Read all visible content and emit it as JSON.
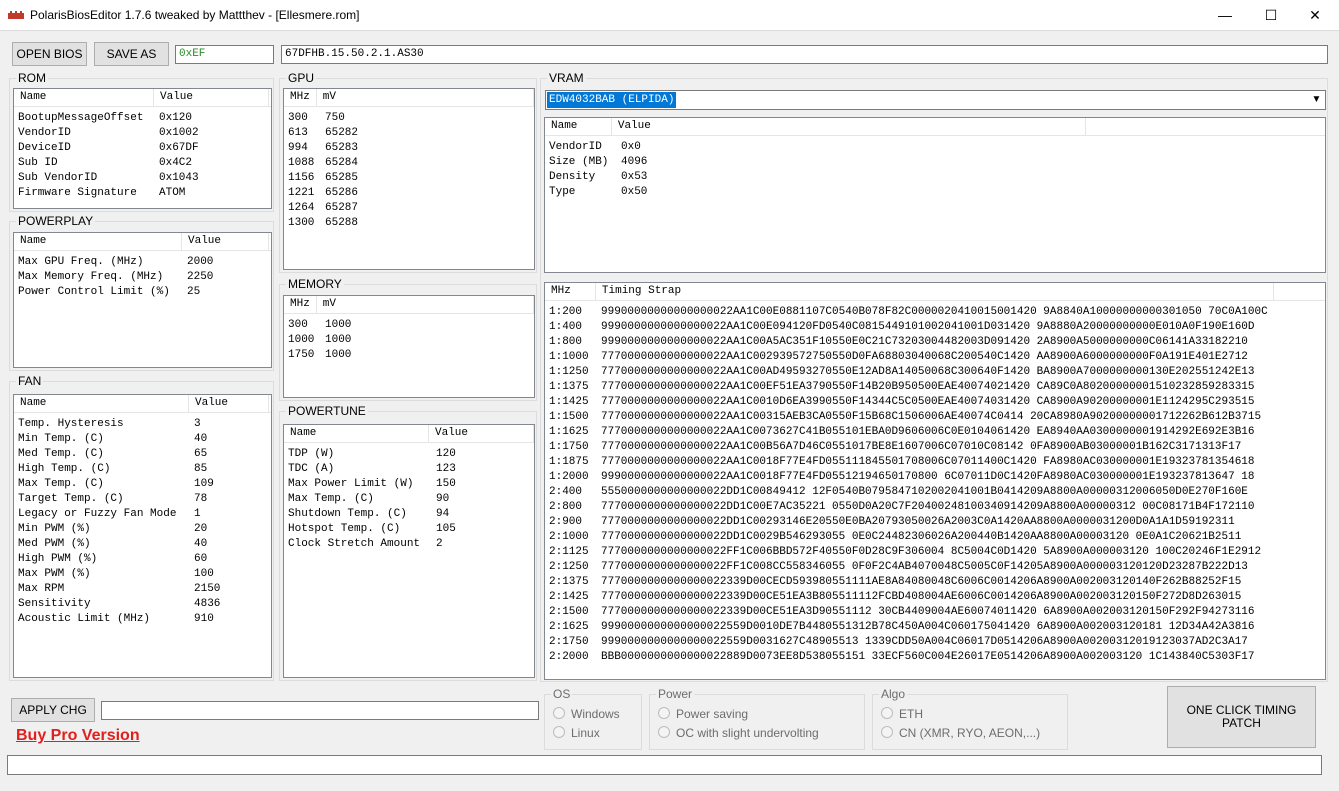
{
  "window": {
    "title": "PolarisBiosEditor 1.7.6 tweaked by Mattthev  - [Ellesmere.rom]",
    "minimize": "—",
    "maximize": "☐",
    "close": "✕"
  },
  "toolbar": {
    "open_bios": "OPEN BIOS",
    "save_as": "SAVE AS",
    "checksum": "0xEF",
    "bios_id": "67DFHB.15.50.2.1.AS30"
  },
  "rom": {
    "title": "ROM",
    "headers": [
      "Name",
      "Value"
    ],
    "rows": [
      [
        "BootupMessageOffset",
        "0x120"
      ],
      [
        "VendorID",
        "0x1002"
      ],
      [
        "DeviceID",
        "0x67DF"
      ],
      [
        "Sub ID",
        "0x4C2"
      ],
      [
        "Sub VendorID",
        "0x1043"
      ],
      [
        "Firmware Signature",
        "ATOM"
      ]
    ]
  },
  "powerplay": {
    "title": "POWERPLAY",
    "headers": [
      "Name",
      "Value"
    ],
    "rows": [
      [
        "Max GPU Freq. (MHz)",
        "2000"
      ],
      [
        "Max Memory Freq. (MHz)",
        "2250"
      ],
      [
        "Power Control Limit (%)",
        "25"
      ]
    ]
  },
  "fan": {
    "title": "FAN",
    "headers": [
      "Name",
      "Value"
    ],
    "rows": [
      [
        "Temp. Hysteresis",
        "3"
      ],
      [
        "Min Temp. (C)",
        "40"
      ],
      [
        "Med Temp. (C)",
        "65"
      ],
      [
        "High Temp. (C)",
        "85"
      ],
      [
        "Max Temp. (C)",
        "109"
      ],
      [
        "Target Temp. (C)",
        "78"
      ],
      [
        "Legacy or Fuzzy Fan Mode",
        "1"
      ],
      [
        "Min PWM (%)",
        "20"
      ],
      [
        "Med PWM (%)",
        "40"
      ],
      [
        "High PWM (%)",
        "60"
      ],
      [
        "Max PWM (%)",
        "100"
      ],
      [
        "Max RPM",
        "2150"
      ],
      [
        "Sensitivity",
        "4836"
      ],
      [
        "Acoustic Limit (MHz)",
        "910"
      ]
    ]
  },
  "gpu": {
    "title": "GPU",
    "headers": [
      "MHz",
      "mV"
    ],
    "rows": [
      [
        "300",
        "750"
      ],
      [
        "613",
        "65282"
      ],
      [
        "994",
        "65283"
      ],
      [
        "1088",
        "65284"
      ],
      [
        "1156",
        "65285"
      ],
      [
        "1221",
        "65286"
      ],
      [
        "1264",
        "65287"
      ],
      [
        "1300",
        "65288"
      ]
    ]
  },
  "memory": {
    "title": "MEMORY",
    "headers": [
      "MHz",
      "mV"
    ],
    "rows": [
      [
        "300",
        "1000"
      ],
      [
        "1000",
        "1000"
      ],
      [
        "1750",
        "1000"
      ]
    ]
  },
  "powertune": {
    "title": "POWERTUNE",
    "headers": [
      "Name",
      "Value"
    ],
    "rows": [
      [
        "TDP (W)",
        "120"
      ],
      [
        "TDC (A)",
        "123"
      ],
      [
        "Max Power Limit (W)",
        "150"
      ],
      [
        "Max Temp. (C)",
        "90"
      ],
      [
        "Shutdown Temp. (C)",
        "94"
      ],
      [
        "Hotspot Temp. (C)",
        "105"
      ],
      [
        "Clock Stretch Amount",
        "2"
      ]
    ]
  },
  "vram": {
    "title": "VRAM",
    "selected": "EDW4032BAB (ELPIDA)",
    "headers": [
      "Name",
      "Value"
    ],
    "rows": [
      [
        "VendorID",
        "0x0"
      ],
      [
        "Size (MB)",
        "4096"
      ],
      [
        "Density",
        "0x53"
      ],
      [
        "Type",
        "0x50"
      ]
    ]
  },
  "timings": {
    "headers": [
      "MHz",
      "Timing Strap"
    ],
    "rows": [
      [
        "1:200",
        "99900000000000000022AA1C00E0881107C0540B078F82C0000020410015001420 9A8840A10000000000301050 70C0A100C"
      ],
      [
        "1:400",
        "9990000000000000022AA1C00E094120FD0540C0815449101002041001D031420 9A8880A20000000000E010A0F190E160D"
      ],
      [
        "1:800",
        "9990000000000000022AA1C00A5AC351F10550E0C21C73203004482003D091420 2A8900A5000000000C06141A33182210"
      ],
      [
        "1:1000",
        "7770000000000000022AA1C002939572750550D0FA68803040068C200540C1420 AA8900A6000000000F0A191E401E2712"
      ],
      [
        "1:1250",
        "7770000000000000022AA1C00AD49593270550E12AD8A14050068C300640F1420 BA8900A7000000000130E202551242E13"
      ],
      [
        "1:1375",
        "7770000000000000022AA1C00EF51EA3790550F14B20B950500EAE40074021420 CA89C0A80200000001510232859283315"
      ],
      [
        "1:1425",
        "7770000000000000022AA1C0010D6EA3990550F14344C5C0500EAE40074031420 CA8900A90200000001E1124295C293515"
      ],
      [
        "1:1500",
        "7770000000000000022AA1C00315AEB3CA0550F15B68C1506006AE40074C0414 20CA8980A90200000001712262B612B3715"
      ],
      [
        "1:1625",
        "7770000000000000022AA1C0073627C41B055101EBA0D9606006C0E0104061420 EA8940AA0300000001914292E692E3B16"
      ],
      [
        "1:1750",
        "7770000000000000022AA1C00B56A7D46C0551017BE8E1607006C07010C08142 0FA8900AB03000001B162C3171313F17"
      ],
      [
        "1:1875",
        "7770000000000000022AA1C0018F77E4FD055111845501708006C07011400C1420 FA8980AC030000001E19323781354618"
      ],
      [
        "1:2000",
        "9990000000000000022AA1C0018F77E4FD05512194650170800 6C07011D0C1420FA8980AC030000001E193237813647 18"
      ],
      [
        "2:400",
        "5550000000000000022DD1C00849412 12F0540B0795847102002041001B0414209A8800A00000312006050D0E270F160E"
      ],
      [
        "2:800",
        "7770000000000000022DD1C00E7AC35221 0550D0A20C7F20400248100340914209A8800A00000312 00C08171B4F172110"
      ],
      [
        "2:900",
        "7770000000000000022DD1C00293146E20550E0BA20793050026A2003C0A1420AA8800A0000031200D0A1A1D59192311"
      ],
      [
        "2:1000",
        "7770000000000000022DD1C0029B546293055 0E0C24482306026A200440B1420AA8800A00003120 0E0A1C20621B2511"
      ],
      [
        "2:1125",
        "7770000000000000022FF1C006BBD572F40550F0D28C9F306004 8C5004C0D1420 5A8900A000003120 100C20246F1E2912"
      ],
      [
        "2:1250",
        "7770000000000000022FF1C008CC558346055 0F0F2C4AB4070048C5005C0F14205A8900A000003120120D23287B222D13"
      ],
      [
        "2:1375",
        "7770000000000000022339D00CECD593980551111AE8A84080048C6006C0014206A8900A002003120140F262B88252F15"
      ],
      [
        "2:1425",
        "7770000000000000022339D00CE51EA3B805511112FCBD408004AE6006C0014206A8900A002003120150F272D8D263015"
      ],
      [
        "2:1500",
        "7770000000000000022339D00CE51EA3D90551112 30CB4409004AE60074011420 6A8900A002003120150F292F94273116"
      ],
      [
        "2:1625",
        "9990000000000000022559D0010DE7B4480551312B78C450A004C060175041420 6A8900A002003120181 12D34A42A3816"
      ],
      [
        "2:1750",
        "9990000000000000022559D0031627C48905513 1339CDD50A004C06017D0514206A8900A00200312019123037AD2C3A17"
      ],
      [
        "2:2000",
        "BBB0000000000000022889D0073EE8D538055151 33ECF560C004E26017E0514206A8900A002003120 1C143840C5303F17"
      ]
    ]
  },
  "bottom": {
    "apply": "APPLY CHG",
    "status_field": "",
    "buy_pro": "Buy Pro Version",
    "one_click_line1": "ONE CLICK TIMING",
    "one_click_line2": "PATCH",
    "status_bar": ""
  },
  "os": {
    "title": "OS",
    "options": [
      "Windows",
      "Linux"
    ]
  },
  "power": {
    "title": "Power",
    "options": [
      "Power saving",
      "OC with slight undervolting"
    ]
  },
  "algo": {
    "title": "Algo",
    "options": [
      "ETH",
      "CN (XMR, RYO, AEON,...)"
    ]
  }
}
